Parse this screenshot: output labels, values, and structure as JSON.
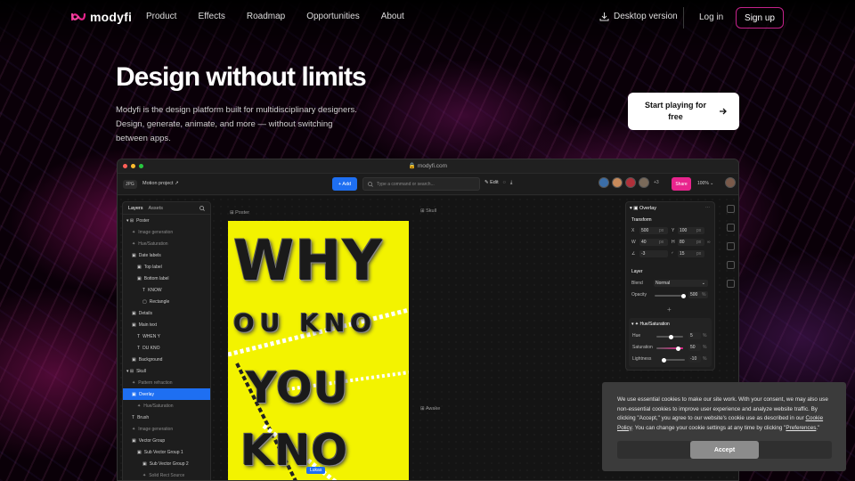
{
  "nav": {
    "brand": "modyfi",
    "links": [
      "Product",
      "Effects",
      "Roadmap",
      "Opportunities",
      "About"
    ],
    "desktop": "Desktop version",
    "login": "Log in",
    "signup": "Sign up"
  },
  "hero": {
    "title": "Design without limits",
    "subtitle": "Modyfi is the design platform built for multidisciplinary designers. Design, generate, animate, and more — without switching between apps.",
    "cta": "Start playing for free"
  },
  "app": {
    "url": "modyfi.com",
    "project_badge": "JPG",
    "project_name": "Motion project ↗",
    "add_label": "+ Add",
    "command_placeholder": "Type a command or search...",
    "edit_label": "Edit",
    "collab_more": "+3",
    "share_label": "Share",
    "zoom": "100%",
    "layers_tab": "Layers",
    "assets_tab": "Assets",
    "layers": [
      {
        "label": "Poster",
        "indent": 0,
        "kind": "frame"
      },
      {
        "label": "Image generation",
        "indent": 1,
        "kind": "dim"
      },
      {
        "label": "Hue/Saturation",
        "indent": 1,
        "kind": "dim"
      },
      {
        "label": "Date labels",
        "indent": 1,
        "kind": "group"
      },
      {
        "label": "Top label",
        "indent": 2,
        "kind": "group"
      },
      {
        "label": "Bottom label",
        "indent": 2,
        "kind": "group"
      },
      {
        "label": "KNOW",
        "indent": 3,
        "kind": "text"
      },
      {
        "label": "Rectangle",
        "indent": 3,
        "kind": "shape"
      },
      {
        "label": "Details",
        "indent": 1,
        "kind": "group"
      },
      {
        "label": "Main text",
        "indent": 1,
        "kind": "group"
      },
      {
        "label": "WHEN Y",
        "indent": 2,
        "kind": "text"
      },
      {
        "label": "DU KNO",
        "indent": 2,
        "kind": "text"
      },
      {
        "label": "Background",
        "indent": 1,
        "kind": "group"
      },
      {
        "label": "Skull",
        "indent": 0,
        "kind": "frame"
      },
      {
        "label": "Pattern refraction",
        "indent": 1,
        "kind": "dim"
      },
      {
        "label": "Overlay",
        "indent": 1,
        "kind": "selected"
      },
      {
        "label": "Hue/Saturation",
        "indent": 2,
        "kind": "dim"
      },
      {
        "label": "Brush",
        "indent": 1,
        "kind": "text"
      },
      {
        "label": "Image generation",
        "indent": 1,
        "kind": "dim"
      },
      {
        "label": "Vector Group",
        "indent": 1,
        "kind": "group"
      },
      {
        "label": "Sub Vector Group 1",
        "indent": 2,
        "kind": "group"
      },
      {
        "label": "Sub Vector Group 2",
        "indent": 3,
        "kind": "group"
      },
      {
        "label": "Solid Rect Source",
        "indent": 3,
        "kind": "dim"
      }
    ],
    "frames": {
      "poster": "Poster",
      "skull": "Skull",
      "awake": "Awake"
    },
    "poster_lines": [
      "WHY",
      "OU KNO",
      "YOU",
      "KNO"
    ],
    "cursor_label": "Lukas",
    "props": {
      "title": "Overlay",
      "transform": "Transform",
      "x_label": "X",
      "x": "500",
      "y_label": "Y",
      "y": "100",
      "w_label": "W",
      "w": "40",
      "h_label": "H",
      "h": "80",
      "angle": "-3",
      "radius": "15",
      "unit": "px",
      "layer": "Layer",
      "blend_label": "Blend",
      "blend": "Normal",
      "opacity_label": "Opacity",
      "opacity": "500",
      "opacity_unit": "%",
      "hue_title": "Hue/Saturation",
      "hue_label": "Hue",
      "hue": "5",
      "sat_label": "Saturation",
      "sat": "50",
      "light_label": "Lightness",
      "light": "-10",
      "pct": "%"
    }
  },
  "cookie": {
    "text_1": "We use essential cookies to make our site work. With your consent, we may also use non-essential cookies to improve user experience and analyze website traffic. By clicking \"Accept,\" you agree to our website's cookie use as described in our ",
    "link_1": "Cookie Policy",
    "text_2": ". You can change your cookie settings at any time by clicking \"",
    "link_2": "Preferences",
    "text_3": ".\"",
    "accept": "Accept"
  }
}
